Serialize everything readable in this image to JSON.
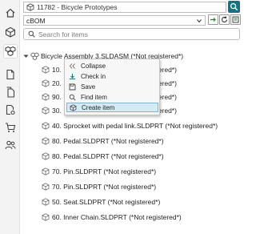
{
  "colors": {
    "accent": "#157184",
    "highlight": "#d4ebf5",
    "highlight_border": "#7fb5d1",
    "sidebar": "#f3f3f3"
  },
  "sidebar": {
    "items": [
      {
        "icon": "home-icon"
      },
      {
        "icon": "cube-icon"
      },
      {
        "icon": "structure-icon",
        "active": true
      },
      {
        "icon": "document-icon"
      },
      {
        "icon": "files-icon"
      },
      {
        "icon": "document-gear-icon"
      },
      {
        "icon": "cart-icon"
      },
      {
        "icon": "users-icon"
      }
    ]
  },
  "header": {
    "title": "11782 - Bicycle Prototypes"
  },
  "bom_select": {
    "value": "cBOM"
  },
  "search": {
    "placeholder": "Search for items"
  },
  "tree": {
    "root": {
      "label": "Bicycle Assembly 3.SLDASM (*Not registered*)"
    },
    "rows": [
      {
        "label": "10.",
        "suffix": "registered*)"
      },
      {
        "label": "20.",
        "suffix": "registered*)"
      },
      {
        "label": "90.",
        "suffix": "registered*)"
      },
      {
        "label": "30.",
        "suffix": "registered*)"
      },
      {
        "label": "40. Sprocket with pedal link.SLDPRT (*Not registered*)"
      },
      {
        "label": "80. Pedal.SLDPRT (*Not registered*)"
      },
      {
        "label": "80. Pedal.SLDPRT (*Not registered*)"
      },
      {
        "label": "70. Pin.SLDPRT (*Not registered*)"
      },
      {
        "label": "70. Pin.SLDPRT (*Not registered*)"
      },
      {
        "label": "50. Seat.SLDPRT (*Not registered*)"
      },
      {
        "label": "60. Inner Chain.SLDPRT (*Not registered*)"
      }
    ]
  },
  "context_menu": {
    "items": [
      {
        "label": "Collapse",
        "icon": "collapse-icon"
      },
      {
        "label": "Check in",
        "icon": "check-in-icon"
      },
      {
        "label": "Save",
        "icon": "save-icon"
      },
      {
        "label": "Find item",
        "icon": "find-icon"
      },
      {
        "label": "Create item",
        "icon": "create-item-icon",
        "highlighted": true
      }
    ]
  }
}
